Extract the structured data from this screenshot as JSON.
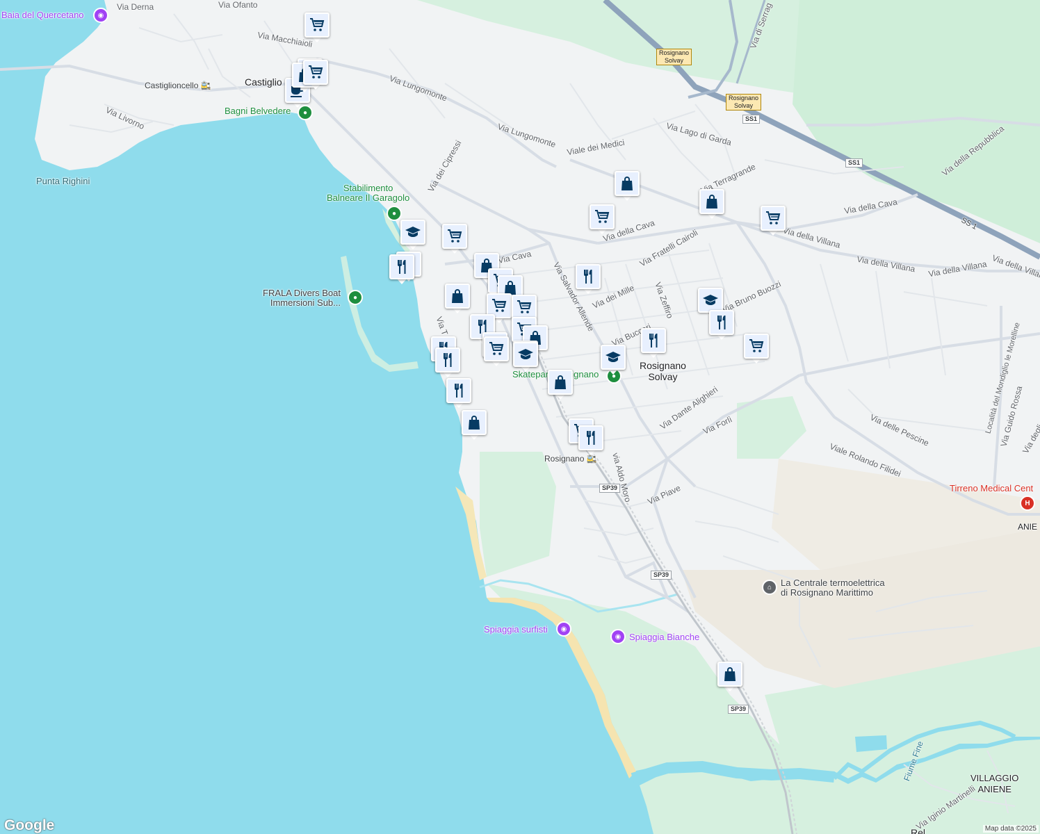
{
  "map": {
    "streets": [
      "Via Derna",
      "Via Ofanto",
      "Via Macchiaioli",
      "Via Lungomonte",
      "Via Lungomonte",
      "Via Livorno",
      "Viale dei Medici",
      "Via dei Cipressi",
      "Via della Cava",
      "Via della Cava",
      "Via Lago di Garda",
      "Via della Repubblica",
      "Via Fratelli Cairoli",
      "Via Cava",
      "Via Salvador Allende",
      "Via dei Mille",
      "Via Zeffiro",
      "Via Bruno Buozzi",
      "Via della Villana",
      "Via della Villana",
      "Via della Villana",
      "Via della Villana",
      "Via Buccari",
      "Via Dante Alighieri",
      "Via Forlì",
      "Via delle Pescine",
      "Viale Rolando Filidei",
      "via Aldo Moro",
      "Via Piave",
      "Via Guido Rossa",
      "Via degli A",
      "Località del Mondiglio le Morelline",
      "Via Iginio Martinelli",
      "Via di Serrag",
      "Via T",
      "Via Terragrande"
    ],
    "places": {
      "castiglioncello": "Castiglio",
      "castiglioncello_station": "Castiglioncello",
      "rosignano_solvay": [
        "Rosignano",
        "Solvay"
      ],
      "rosignano_station": "Rosignano",
      "villaggio_aniene": [
        "VILLAGGIO",
        "ANIENE"
      ],
      "aniene": "ANIE",
      "bottom_cut": "Rel"
    },
    "pois": {
      "baia": "Baia del Quercetano",
      "bagni": "Bagni Belvedere",
      "punta": "Punta Righini",
      "stabilimento": [
        "Stabilimento",
        "Balneare Il Garagolo"
      ],
      "frala": [
        "FRALA Divers Boat",
        "Immersioni Sub..."
      ],
      "skatepark": "Skatepark Rosignano",
      "centrale": [
        "La Centrale termoelettrica",
        "di Rosignano Marittimo"
      ],
      "surfisti": "Spiaggia surfisti",
      "bianche": "Spiaggia Bianche",
      "tirreno": "Tirreno Medical Cent",
      "fiume": "Fiume Fine"
    },
    "shields": {
      "ss1": "SS1",
      "ss1b": "SS1",
      "ss1c": "SS 1",
      "sp39a": "SP39",
      "sp39b": "SP39",
      "sp39c": "SP39",
      "exit1": [
        "Rosignano",
        "Solvay"
      ],
      "exit2": [
        "Rosignano",
        "Solvay"
      ]
    },
    "markers": [
      {
        "icon": "cart-icon"
      },
      {
        "icon": "cart-icon"
      },
      {
        "icon": "cafe-icon"
      },
      {
        "icon": "bag-icon"
      },
      {
        "icon": "cart-icon"
      },
      {
        "icon": "bag-icon"
      },
      {
        "icon": "cart-icon"
      },
      {
        "icon": "cart-icon"
      },
      {
        "icon": "school-icon"
      },
      {
        "icon": "restaurant-icon"
      },
      {
        "icon": "restaurant-icon"
      },
      {
        "icon": "cart-icon"
      },
      {
        "icon": "bag-icon"
      },
      {
        "icon": "bag-icon"
      },
      {
        "icon": "restaurant-icon"
      },
      {
        "icon": "cart-icon"
      },
      {
        "icon": "bag-icon"
      },
      {
        "icon": "cart-icon"
      },
      {
        "icon": "cart-icon"
      },
      {
        "icon": "cart-icon"
      },
      {
        "icon": "restaurant-icon"
      },
      {
        "icon": "restaurant-icon"
      },
      {
        "icon": "bag-icon"
      },
      {
        "icon": "cart-icon"
      },
      {
        "icon": "school-icon"
      },
      {
        "icon": "school-icon"
      },
      {
        "icon": "school-icon"
      },
      {
        "icon": "restaurant-icon"
      },
      {
        "icon": "restaurant-icon"
      },
      {
        "icon": "restaurant-icon"
      },
      {
        "icon": "restaurant-icon"
      },
      {
        "icon": "restaurant-icon"
      },
      {
        "icon": "bag-icon"
      },
      {
        "icon": "cart-icon"
      },
      {
        "icon": "restaurant-icon"
      },
      {
        "icon": "cart-icon"
      },
      {
        "icon": "school-icon"
      },
      {
        "icon": "bag-icon"
      }
    ],
    "logo": "Google",
    "attribution": "Map data ©2025"
  }
}
